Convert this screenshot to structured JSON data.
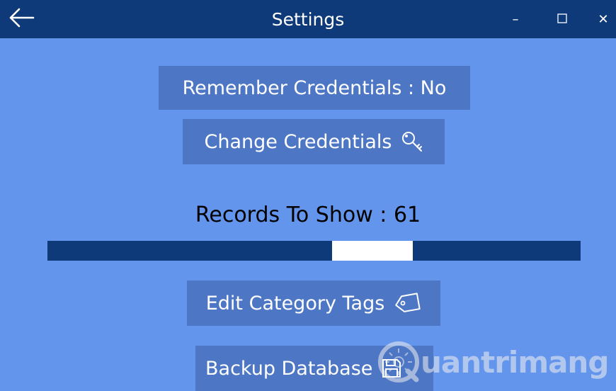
{
  "window": {
    "title": "Settings",
    "back_icon": "arrow-left-icon",
    "minimize_glyph": "–",
    "maximize_icon": "square-icon",
    "close_glyph": "✕"
  },
  "buttons": {
    "remember_credentials": "Remember Credentials : No",
    "change_credentials": "Change Credentials",
    "edit_category_tags": "Edit Category Tags",
    "backup_database": "Backup Database"
  },
  "icons": {
    "change_credentials": "key-icon",
    "edit_category_tags": "tag-icon",
    "backup_database": "save-icon"
  },
  "records": {
    "label": "Records To Show : 61",
    "slider_min": 0,
    "slider_max": 100,
    "slider_value": 61
  },
  "watermark": {
    "text": "uantrimang",
    "logo_letter": "Q"
  },
  "colors": {
    "accent": "#0f3a7a",
    "background": "#6495ed",
    "button": "#4d77c4"
  }
}
